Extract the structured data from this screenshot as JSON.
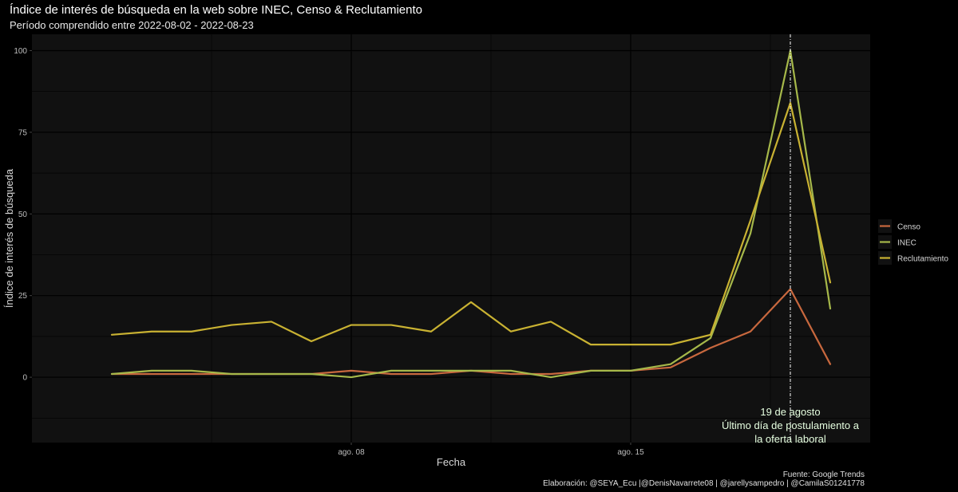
{
  "chart_data": {
    "type": "line",
    "title": "Índice de interés de búsqueda en la web sobre INEC, Censo & Reclutamiento",
    "subtitle": "Período comprendido entre 2022-08-02 - 2022-08-23",
    "xlabel": "Fecha",
    "ylabel": "Índice de interés de búsqueda",
    "x": [
      "2022-08-02",
      "2022-08-03",
      "2022-08-04",
      "2022-08-05",
      "2022-08-06",
      "2022-08-07",
      "2022-08-08",
      "2022-08-09",
      "2022-08-10",
      "2022-08-11",
      "2022-08-12",
      "2022-08-13",
      "2022-08-14",
      "2022-08-15",
      "2022-08-16",
      "2022-08-17",
      "2022-08-18",
      "2022-08-19",
      "2022-08-20"
    ],
    "xlim": [
      "2022-07-31",
      "2022-08-21"
    ],
    "x_ticks": [
      {
        "date": "2022-08-08",
        "label": "ago. 08"
      },
      {
        "date": "2022-08-15",
        "label": "ago. 15"
      }
    ],
    "ylim": [
      -20,
      105
    ],
    "y_ticks": [
      0,
      25,
      50,
      75,
      100
    ],
    "grid": true,
    "legend_position": "right",
    "series": [
      {
        "name": "Censo",
        "color": "#c8683e",
        "values": [
          1,
          1,
          1,
          1,
          1,
          1,
          2,
          1,
          1,
          2,
          1,
          1,
          2,
          2,
          3,
          9,
          14,
          27,
          4
        ]
      },
      {
        "name": "INEC",
        "color": "#a6b84a",
        "values": [
          1,
          2,
          2,
          1,
          1,
          1,
          0,
          2,
          2,
          2,
          2,
          0,
          2,
          2,
          4,
          12,
          44,
          100,
          21
        ]
      },
      {
        "name": "Reclutamiento",
        "color": "#c9b232",
        "values": [
          13,
          14,
          14,
          16,
          17,
          11,
          16,
          16,
          14,
          23,
          14,
          17,
          10,
          10,
          10,
          13,
          48,
          84,
          29
        ]
      }
    ],
    "annotation": {
      "date": "2022-08-19",
      "line_color": "#ffffff",
      "text_color": "#e6ffe0",
      "lines": [
        "19 de agosto",
        "Último día de postulamiento a",
        "la oferta laboral"
      ]
    },
    "panel_color": "#111111",
    "gridline_color": "#000000"
  },
  "captions": {
    "source": "Fuente: Google Trends",
    "credits": "Elaboración: @SEYA_Ecu |@DenisNavarrete08 | @jarellysampedro | @CamilaS01241778"
  }
}
